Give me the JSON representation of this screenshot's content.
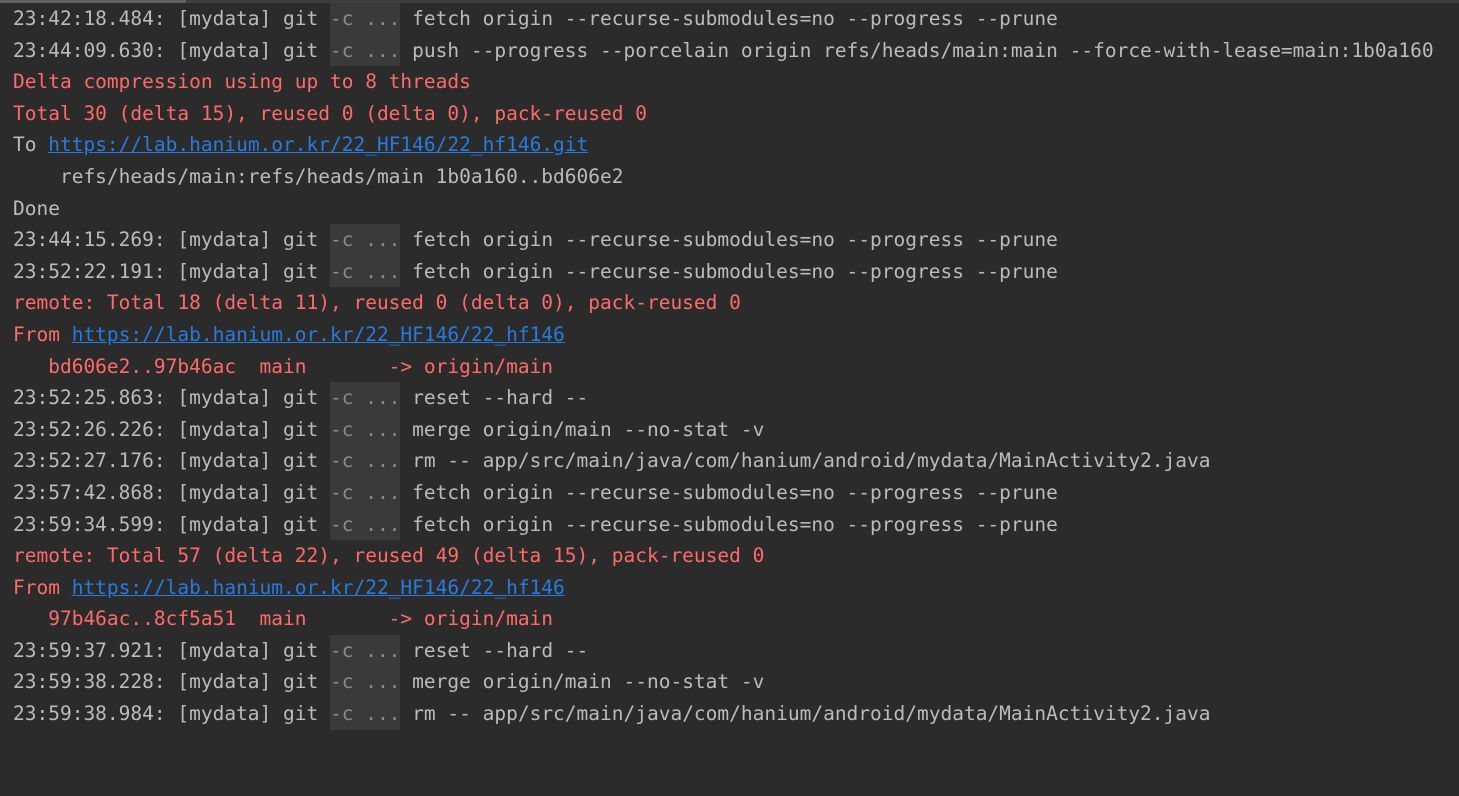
{
  "lines": [
    {
      "type": "cmd",
      "prefix": "23:42:18.484: [mydata] git ",
      "fold": "-c ...",
      "rest": " fetch origin --recurse-submodules=no --progress --prune"
    },
    {
      "type": "cmd",
      "prefix": "23:44:09.630: [mydata] git ",
      "fold": "-c ...",
      "rest": " push --progress --porcelain origin refs/heads/main:main --force-with-lease=main:1b0a160"
    },
    {
      "type": "err",
      "text": "Delta compression using up to 8 threads"
    },
    {
      "type": "err",
      "text": "Total 30 (delta 15), reused 0 (delta 0), pack-reused 0"
    },
    {
      "type": "link",
      "prefix": "To ",
      "link": "https://lab.hanium.or.kr/22_HF146/22_hf146.git",
      "link_class": "normal"
    },
    {
      "type": "text",
      "text": "    refs/heads/main:refs/heads/main 1b0a160..bd606e2"
    },
    {
      "type": "text",
      "text": "Done"
    },
    {
      "type": "cmd",
      "prefix": "23:44:15.269: [mydata] git ",
      "fold": "-c ...",
      "rest": " fetch origin --recurse-submodules=no --progress --prune"
    },
    {
      "type": "cmd",
      "prefix": "23:52:22.191: [mydata] git ",
      "fold": "-c ...",
      "rest": " fetch origin --recurse-submodules=no --progress --prune"
    },
    {
      "type": "err",
      "text": "remote: Total 18 (delta 11), reused 0 (delta 0), pack-reused 0"
    },
    {
      "type": "link",
      "prefix": "From ",
      "link": "https://lab.hanium.or.kr/22_HF146/22_hf146",
      "link_class": "err"
    },
    {
      "type": "err",
      "text": "   bd606e2..97b46ac  main       -> origin/main"
    },
    {
      "type": "cmd",
      "prefix": "23:52:25.863: [mydata] git ",
      "fold": "-c ...",
      "rest": " reset --hard --"
    },
    {
      "type": "cmd",
      "prefix": "23:52:26.226: [mydata] git ",
      "fold": "-c ...",
      "rest": " merge origin/main --no-stat -v"
    },
    {
      "type": "cmd",
      "prefix": "23:52:27.176: [mydata] git ",
      "fold": "-c ...",
      "rest": " rm -- app/src/main/java/com/hanium/android/mydata/MainActivity2.java"
    },
    {
      "type": "cmd",
      "prefix": "23:57:42.868: [mydata] git ",
      "fold": "-c ...",
      "rest": " fetch origin --recurse-submodules=no --progress --prune"
    },
    {
      "type": "cmd",
      "prefix": "23:59:34.599: [mydata] git ",
      "fold": "-c ...",
      "rest": " fetch origin --recurse-submodules=no --progress --prune"
    },
    {
      "type": "err",
      "text": "remote: Total 57 (delta 22), reused 49 (delta 15), pack-reused 0"
    },
    {
      "type": "link",
      "prefix": "From ",
      "link": "https://lab.hanium.or.kr/22_HF146/22_hf146",
      "link_class": "err"
    },
    {
      "type": "err",
      "text": "   97b46ac..8cf5a51  main       -> origin/main"
    },
    {
      "type": "cmd",
      "prefix": "23:59:37.921: [mydata] git ",
      "fold": "-c ...",
      "rest": " reset --hard --"
    },
    {
      "type": "cmd",
      "prefix": "23:59:38.228: [mydata] git ",
      "fold": "-c ...",
      "rest": " merge origin/main --no-stat -v"
    },
    {
      "type": "cmd",
      "prefix": "23:59:38.984: [mydata] git ",
      "fold": "-c ...",
      "rest": " rm -- app/src/main/java/com/hanium/android/mydata/MainActivity2.java"
    }
  ],
  "colors": {
    "background": "#2b2b2b",
    "text": "#bbbbbb",
    "error": "#ff6b68",
    "link": "#287bde",
    "fold_bg": "#3a3a3a"
  }
}
